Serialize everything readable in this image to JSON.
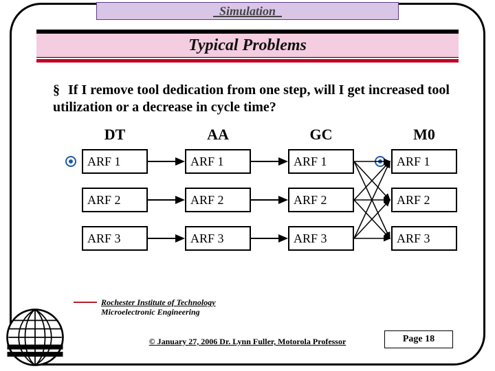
{
  "header": {
    "label": "Simulation"
  },
  "title": "Typical Problems",
  "bullet": {
    "symbol": "§",
    "text": "If I remove tool dedication from one step, will I get increased tool utilization or a decrease in cycle time?"
  },
  "diagram": {
    "columns": [
      "DT",
      "AA",
      "GC",
      "M0"
    ],
    "rows": [
      "ARF 1",
      "ARF 2",
      "ARF 3"
    ]
  },
  "footer": {
    "institution_line1": "Rochester Institute of Technology",
    "institution_line2": "Microelectronic Engineering",
    "copyright": "© January 27, 2006  Dr. Lynn Fuller, Motorola Professor",
    "page": "Page 18"
  },
  "colors": {
    "header_bg": "#d9c5e6",
    "title_bg": "#f4cde0",
    "rule_red": "#c40024"
  }
}
